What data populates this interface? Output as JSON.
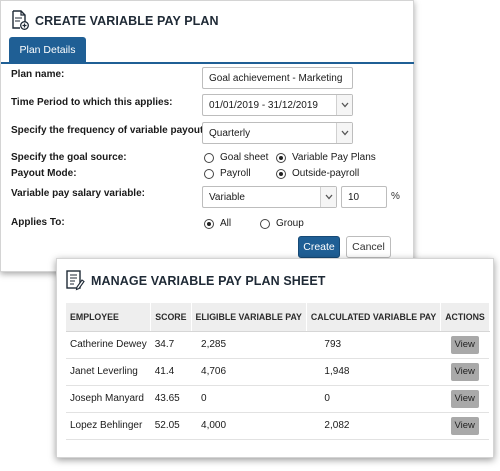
{
  "create_plan": {
    "title": "CREATE VARIABLE PAY PLAN",
    "tab": "Plan Details",
    "fields": {
      "plan_name": {
        "label": "Plan name:",
        "value": "Goal achievement - Marketing"
      },
      "time_period": {
        "label": "Time Period to which this applies:",
        "value": "01/01/2019 - 31/12/2019"
      },
      "frequency": {
        "label": "Specify the frequency of variable payout:",
        "value": "Quarterly"
      },
      "goal_source": {
        "label": "Specify the goal source:",
        "options": [
          "Goal sheet",
          "Variable Pay Plans"
        ],
        "selected": "Variable Pay Plans"
      },
      "payout_mode": {
        "label": "Payout Mode:",
        "options": [
          "Payroll",
          "Outside-payroll"
        ],
        "selected": "Outside-payroll"
      },
      "salary_variable": {
        "label": "Variable pay salary variable:",
        "value": "Variable",
        "percent": "10",
        "percent_unit": "%"
      },
      "applies_to": {
        "label": "Applies To:",
        "options": [
          "All",
          "Group"
        ],
        "selected": "All"
      }
    },
    "buttons": {
      "create": "Create",
      "cancel": "Cancel"
    }
  },
  "manage_sheet": {
    "title": "MANAGE VARIABLE PAY PLAN SHEET",
    "columns": [
      "EMPLOYEE",
      "SCORE",
      "ELIGIBLE VARIABLE PAY",
      "CALCULATED VARIABLE PAY",
      "ACTIONS"
    ],
    "rows": [
      {
        "employee": "Catherine Dewey",
        "score": "34.7",
        "eligible": "2,285",
        "calculated": "793",
        "action": "View"
      },
      {
        "employee": "Janet Leverling",
        "score": "41.4",
        "eligible": "4,706",
        "calculated": "1,948",
        "action": "View"
      },
      {
        "employee": "Joseph Manyard",
        "score": "43.65",
        "eligible": "0",
        "calculated": "0",
        "action": "View"
      },
      {
        "employee": "Lopez Behlinger",
        "score": "52.05",
        "eligible": "4,000",
        "calculated": "2,082",
        "action": "View"
      }
    ]
  },
  "icons": {
    "create_header": "document-plus-icon",
    "manage_header": "document-list-icon",
    "dropdown": "chevron-down-icon"
  },
  "colors": {
    "primary": "#1f5f95",
    "header_bg": "#eeeeee",
    "view_button": "#a9a9a9"
  }
}
